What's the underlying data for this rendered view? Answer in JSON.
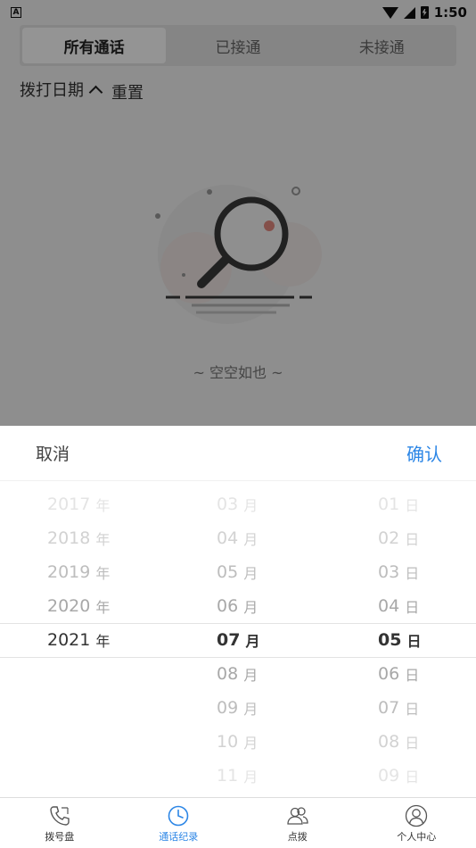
{
  "status_bar": {
    "time": "1:50",
    "left_badge": "A"
  },
  "tabs": [
    {
      "label": "所有通话",
      "active": true
    },
    {
      "label": "已接通",
      "active": false
    },
    {
      "label": "未接通",
      "active": false
    }
  ],
  "filter": {
    "date_label": "拨打日期",
    "reset_label": "重置"
  },
  "empty_state": {
    "text": "~ 空空如也 ~",
    "icon": "magnifier-icon"
  },
  "date_picker": {
    "cancel_label": "取消",
    "confirm_label": "确认",
    "years": [
      "2017",
      "2018",
      "2019",
      "2020",
      "2021"
    ],
    "year_unit": "年",
    "months": [
      "03",
      "04",
      "05",
      "06",
      "07",
      "08",
      "09",
      "10",
      "11"
    ],
    "month_unit": "月",
    "days": [
      "01",
      "02",
      "03",
      "04",
      "05",
      "06",
      "07",
      "08",
      "09"
    ],
    "day_unit": "日",
    "selected": {
      "year": "2021",
      "month": "07",
      "day": "05"
    }
  },
  "bottom_nav": [
    {
      "label": "拨号盘",
      "icon": "phone-icon",
      "active": false
    },
    {
      "label": "通话纪录",
      "icon": "clock-icon",
      "active": true
    },
    {
      "label": "点拨",
      "icon": "users-icon",
      "active": false
    },
    {
      "label": "个人中心",
      "icon": "user-icon",
      "active": false
    }
  ],
  "colors": {
    "accent": "#2c86e6",
    "overlay": "rgba(0,0,0,0.42)"
  }
}
